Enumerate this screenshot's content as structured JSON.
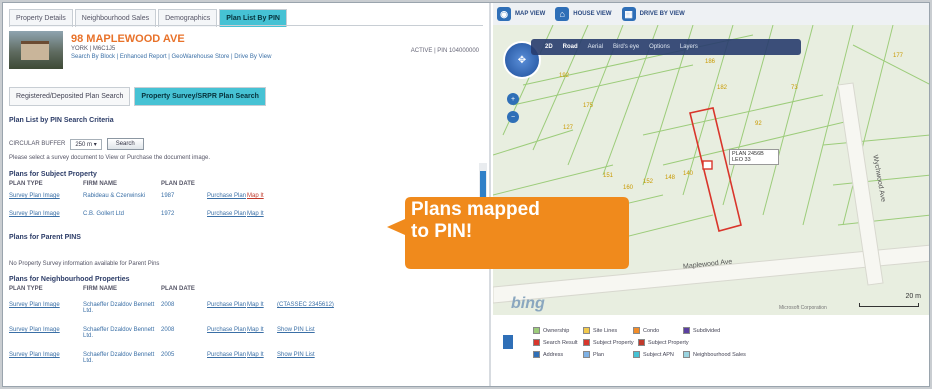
{
  "tabs": [
    "Property Details",
    "Neighbourhood Sales",
    "Demographics",
    "Plan List By PIN"
  ],
  "property": {
    "address": "98 MAPLEWOOD AVE",
    "city": "YORK | M6C1J5",
    "links": "Search By Block | Enhanced Report | GeoWarehouse Store | Drive By View",
    "status": "ACTIVE | PIN 104000000"
  },
  "subtabs": [
    "Registered/Deposited Plan Search",
    "Property Survey/SRPR Plan Search"
  ],
  "criteria": {
    "title": "Plan List by PIN Search Criteria",
    "buffer_label": "CIRCULAR BUFFER",
    "buffer_value": "250 m",
    "search_label": "Search",
    "instructions": "Please select a survey document to View or Purchase the document image."
  },
  "columns": [
    "PLAN TYPE",
    "FIRM NAME",
    "PLAN DATE"
  ],
  "subject": {
    "title": "Plans for Subject Property",
    "rows": [
      {
        "type": "Survey Plan Image",
        "firm": "Rabideau & Czerwinski",
        "date": "1987",
        "purchase": "Purchase Plan",
        "map": "Map It"
      },
      {
        "type": "Survey Plan Image",
        "firm": "C.B. Gollert Ltd",
        "date": "1972",
        "purchase": "Purchase Plan",
        "map": "Map It"
      }
    ]
  },
  "parent": {
    "title": "Plans for Parent PINS",
    "note": "No Property Survey information available for Parent Pins"
  },
  "neighbourhood": {
    "title": "Plans for Neighbourhood Properties",
    "rows": [
      {
        "type": "Survey Plan Image",
        "firm": "Schaeffer Dzaldov Bennett Ltd.",
        "date": "2008",
        "purchase": "Purchase Plan",
        "map": "Map It",
        "extra": "(CTASSEC 2345612)"
      },
      {
        "type": "Survey Plan Image",
        "firm": "Schaeffer Dzaldov Bennett Ltd.",
        "date": "2008",
        "purchase": "Purchase Plan",
        "map": "Map It",
        "extra": "Show PIN List"
      },
      {
        "type": "Survey Plan Image",
        "firm": "Schaeffer Dzaldov Bennett Ltd.",
        "date": "2005",
        "purchase": "Purchase Plan",
        "map": "Map It",
        "extra": "Show PIN List"
      }
    ]
  },
  "map": {
    "views": [
      "MAP VIEW",
      "HOUSE VIEW",
      "DRIVE BY VIEW"
    ],
    "controls": [
      "2D",
      "Road",
      "Aerial",
      "Bird's eye",
      "Options",
      "Layers"
    ],
    "streets": [
      "Maplewood Ave",
      "Wychwood Ave"
    ],
    "plan_label": "PLAN 2456B LEO 33",
    "lot_numbers": [
      "192",
      "186",
      "182",
      "175",
      "127",
      "151",
      "160",
      "152",
      "148",
      "140",
      "92",
      "73",
      "177"
    ],
    "bing": "bing",
    "scale": "20 m",
    "copyright": "Microsoft Corporation"
  },
  "legend": [
    "Ownership",
    "Site Lines",
    "Condo",
    "Subdivided",
    "Search Result",
    "Subject Property",
    "Subject Property",
    "Address",
    "Plan",
    "Subject APN",
    "Neighbourhood Sales"
  ],
  "callout": {
    "line1": "Plans mapped",
    "line2": "to PIN!"
  }
}
